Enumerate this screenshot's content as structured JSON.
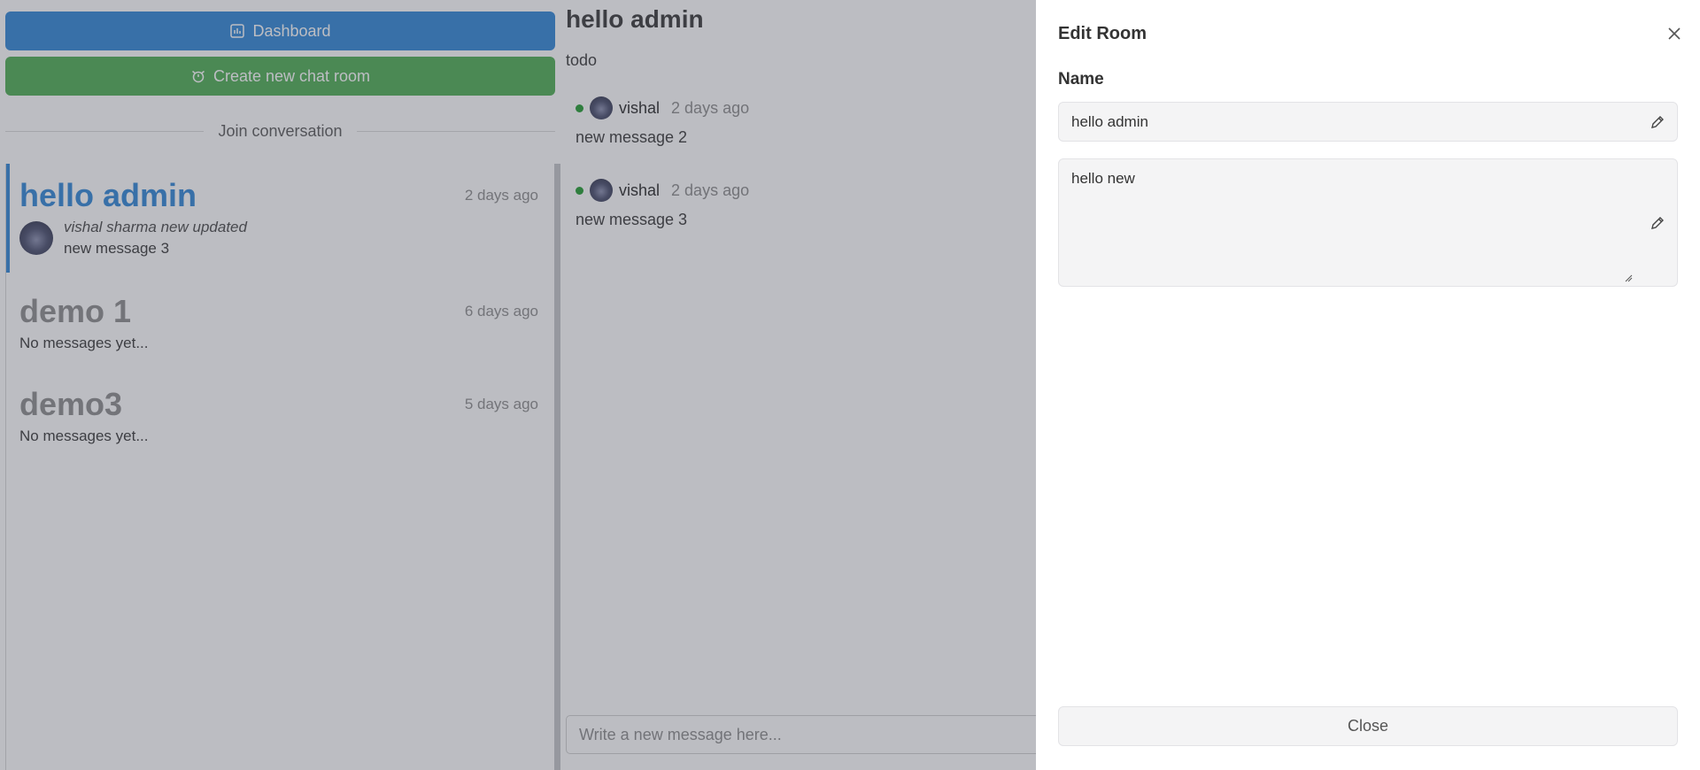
{
  "sidebar": {
    "dashboard_label": "Dashboard",
    "create_room_label": "Create new chat room",
    "join_label": "Join conversation",
    "rooms": [
      {
        "name": "hello admin",
        "time": "2 days ago",
        "sender": "vishal sharma new updated",
        "message": "new message 3"
      },
      {
        "name": "demo 1",
        "time": "6 days ago",
        "preview": "No messages yet..."
      },
      {
        "name": "demo3",
        "time": "5 days ago",
        "preview": "No messages yet..."
      }
    ]
  },
  "chat": {
    "title": "hello admin",
    "description": "todo",
    "messages": [
      {
        "author": "vishal",
        "time": "2 days ago",
        "text": "new message 2"
      },
      {
        "author": "vishal",
        "time": "2 days ago",
        "text": "new message 3"
      }
    ],
    "composer_placeholder": "Write a new message here..."
  },
  "drawer": {
    "title": "Edit Room",
    "name_label": "Name",
    "name_value": "hello admin",
    "description_value": "hello new",
    "close_label": "Close"
  },
  "colors": {
    "primary": "#2b83d6",
    "success": "#4aab4e",
    "online": "#1c9a2a",
    "overlay": "rgba(80,82,95,0.38)"
  }
}
